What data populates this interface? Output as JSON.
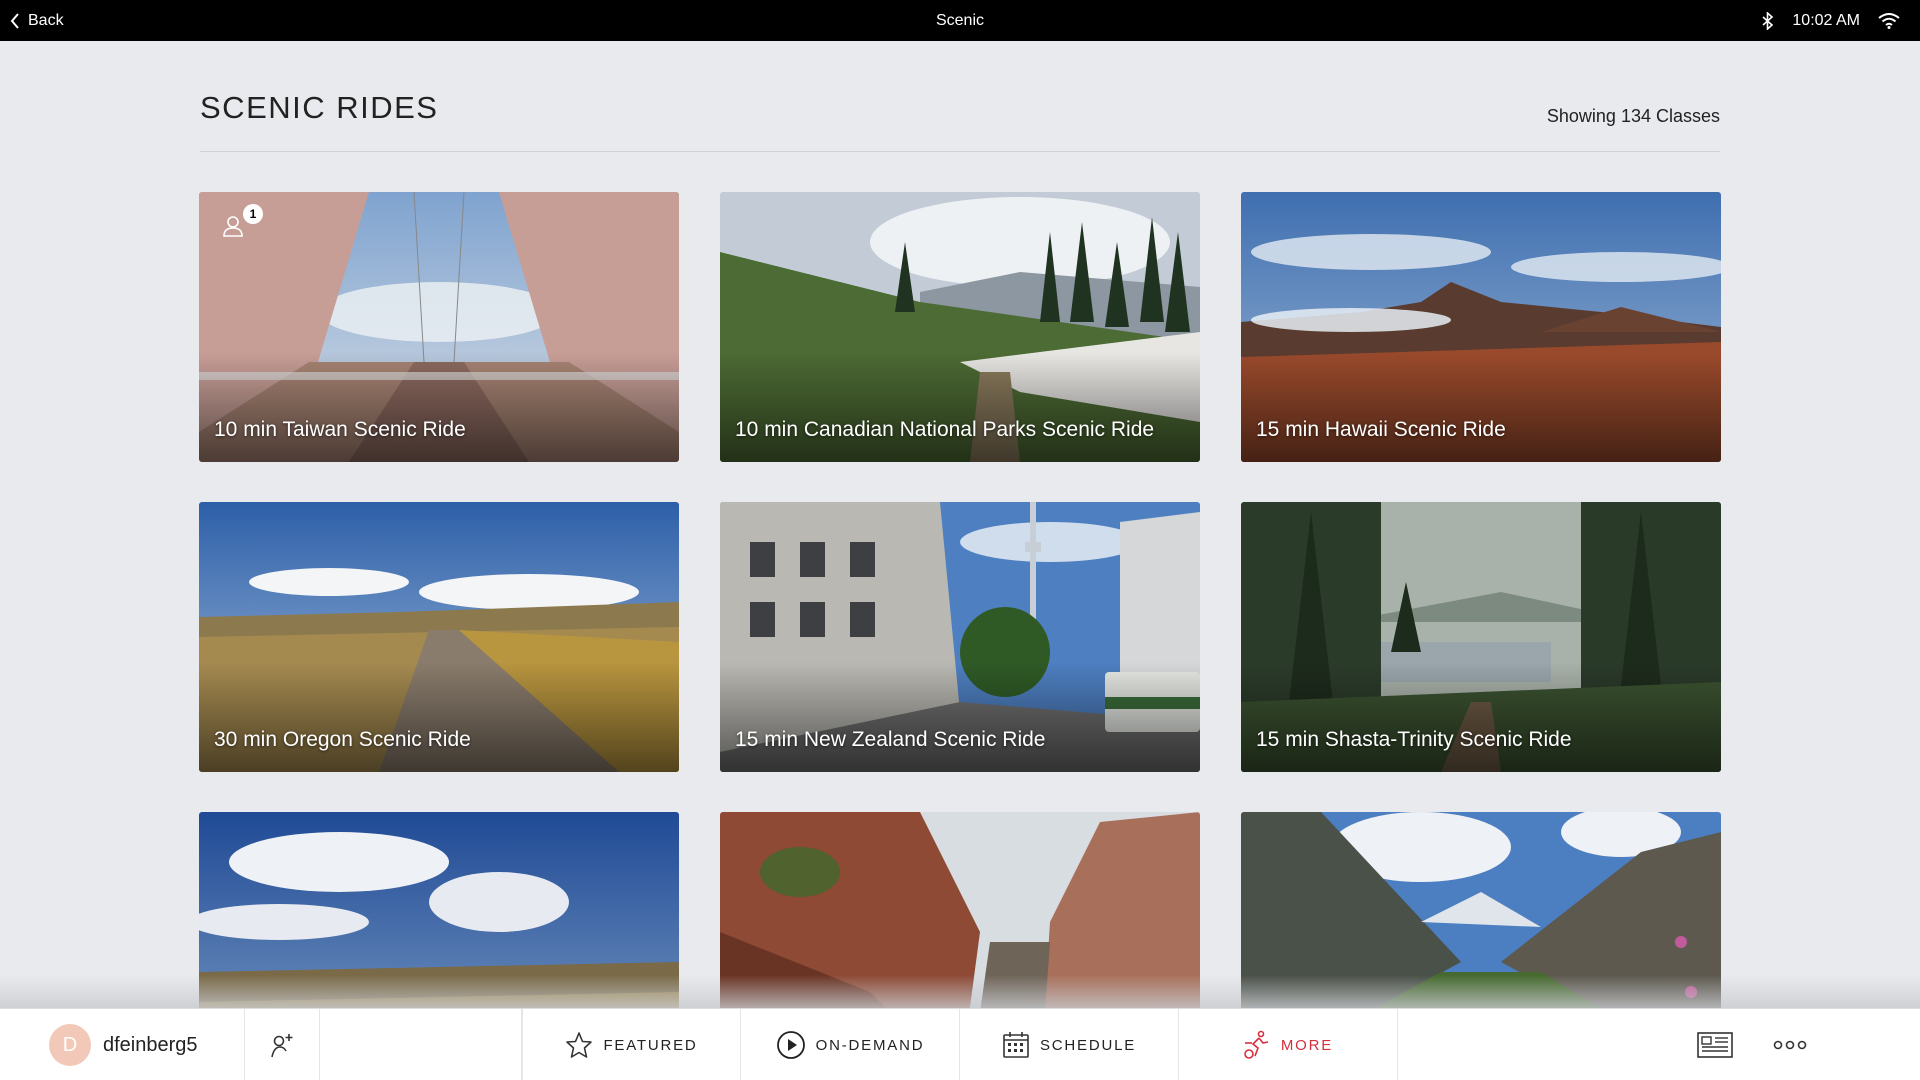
{
  "status_bar": {
    "back_label": "Back",
    "title": "Scenic",
    "time": "10:02 AM"
  },
  "header": {
    "title": "SCENIC RIDES",
    "count": "Showing 134 Classes"
  },
  "classes": [
    {
      "title": "10 min Taiwan Scenic Ride",
      "friends_count": "1"
    },
    {
      "title": "10 min Canadian National Parks Scenic Ride"
    },
    {
      "title": "15 min Hawaii Scenic Ride"
    },
    {
      "title": "30 min Oregon Scenic Ride"
    },
    {
      "title": "15 min New Zealand Scenic Ride"
    },
    {
      "title": "15 min Shasta-Trinity Scenic Ride"
    },
    {
      "title": ""
    },
    {
      "title": ""
    },
    {
      "title": ""
    }
  ],
  "bottom_nav": {
    "avatar_initial": "D",
    "username": "dfeinberg5",
    "tabs": [
      {
        "label": "FEATURED",
        "icon": "star-icon"
      },
      {
        "label": "ON-DEMAND",
        "icon": "play-icon"
      },
      {
        "label": "SCHEDULE",
        "icon": "calendar-icon"
      },
      {
        "label": "MORE",
        "icon": "cyclist-icon",
        "active": true
      }
    ]
  },
  "colors": {
    "accent": "#d62f3d",
    "background": "#e8eaed",
    "status_bar": "#000000"
  }
}
